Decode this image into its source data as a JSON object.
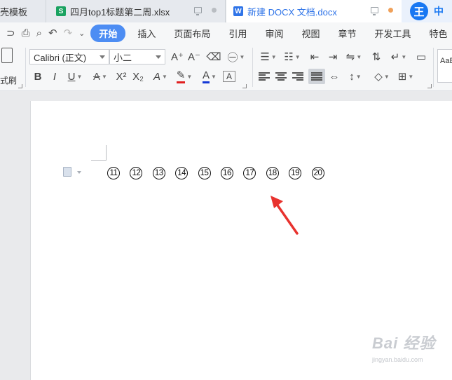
{
  "tabs": [
    {
      "label": "壳模板"
    },
    {
      "label": "四月top1标题第二周.xlsx",
      "icon": "S"
    },
    {
      "label": "新建 DOCX 文档.docx",
      "icon": "W"
    }
  ],
  "brand": {
    "logo": "王",
    "lang": "中"
  },
  "menu": {
    "items": [
      "开始",
      "插入",
      "页面布局",
      "引用",
      "审阅",
      "视图",
      "章节",
      "开发工具",
      "特色"
    ]
  },
  "toolbar": {
    "painter_label": "式刷",
    "font_name": "Calibri (正文)",
    "font_size": "小二",
    "grow_font": "A⁺",
    "shrink_font": "A⁻",
    "phonetic": "㊀",
    "bold": "B",
    "italic": "I",
    "underline": "U",
    "strikethrough": "A",
    "superscript": "X²",
    "subscript": "X₂",
    "text_effect": "A",
    "highlight": "✎",
    "font_color": "A",
    "char_border": "A",
    "style_sample": "AaB"
  },
  "document": {
    "circled_numbers": [
      "11",
      "12",
      "13",
      "14",
      "15",
      "16",
      "17",
      "18",
      "19",
      "20"
    ]
  },
  "watermark": {
    "text": "Bai 经验",
    "sub": "jingyan.baidu.com"
  },
  "colors": {
    "accent": "#4d8df3",
    "arrow": "#e8322e",
    "font_color_bar": "#1538d6",
    "strike_bar": "#e02020"
  }
}
